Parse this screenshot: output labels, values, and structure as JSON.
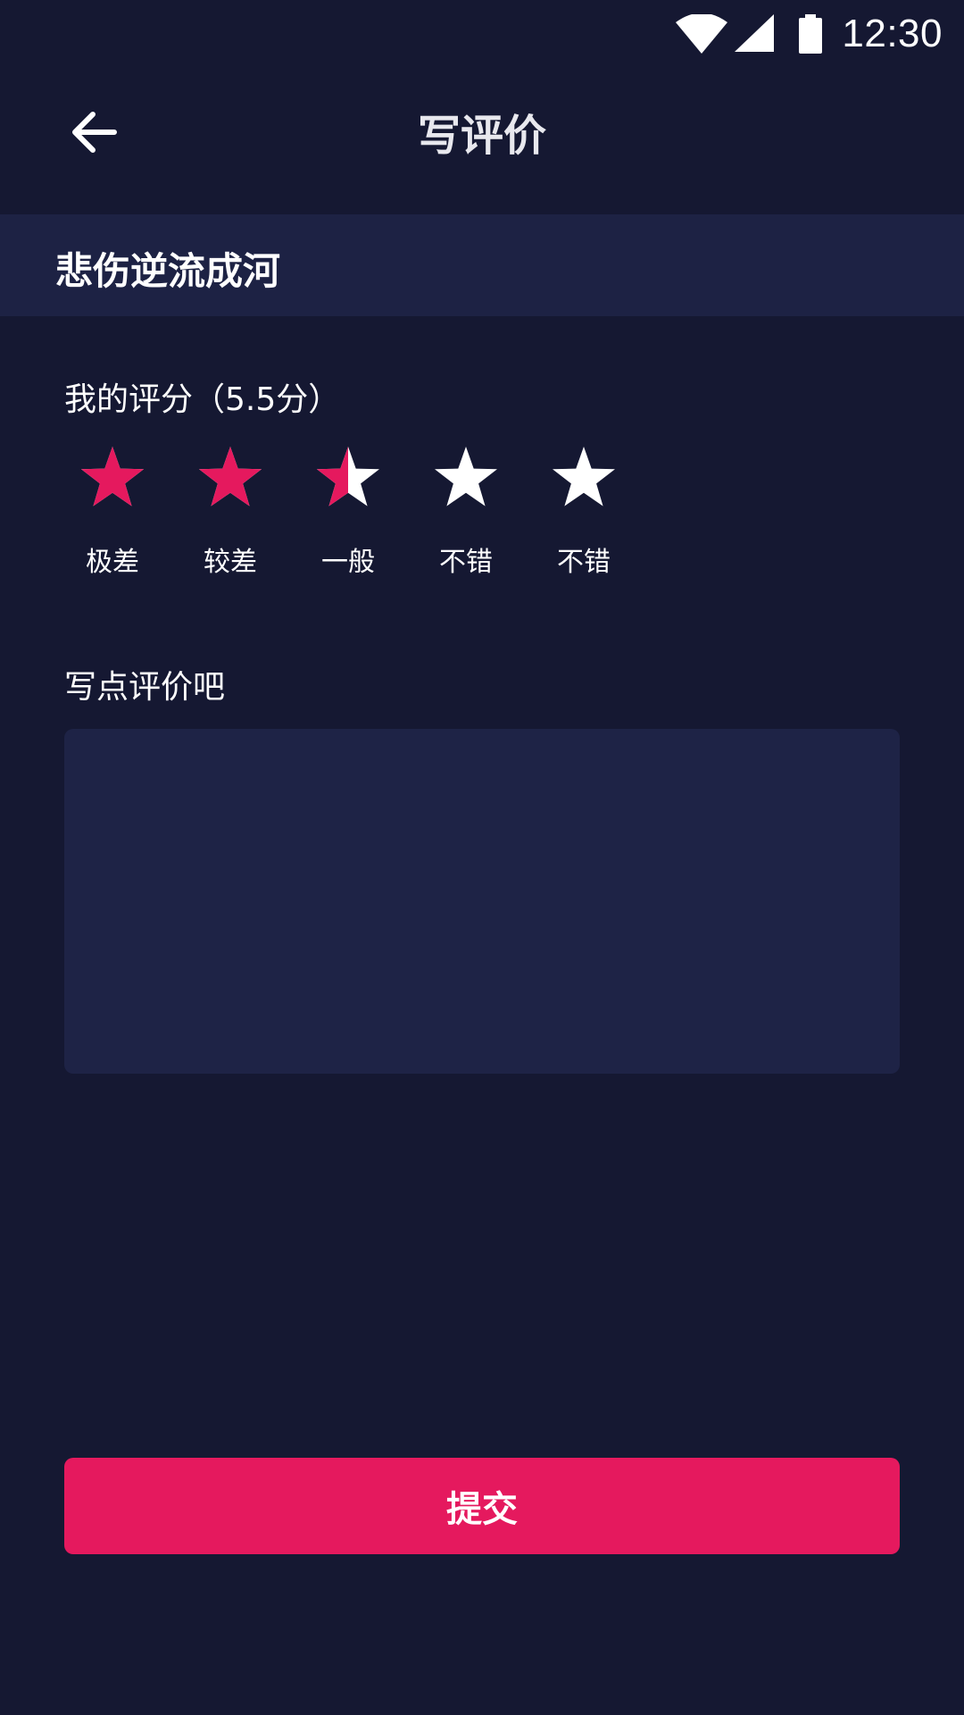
{
  "status_bar": {
    "time": "12:30",
    "icons": [
      "wifi-icon",
      "cellular-signal-icon",
      "battery-icon"
    ]
  },
  "header": {
    "title": "写评价",
    "back_icon": "arrow-left-icon"
  },
  "movie": {
    "title": "悲伤逆流成河"
  },
  "rating": {
    "label": "我的评分（5.5分）",
    "value": 2.5,
    "max": 5,
    "stars": [
      {
        "caption": "极差",
        "fill": 1
      },
      {
        "caption": "较差",
        "fill": 1
      },
      {
        "caption": "一般",
        "fill": 0.5
      },
      {
        "caption": "不错",
        "fill": 0
      },
      {
        "caption": "不错",
        "fill": 0
      }
    ]
  },
  "comment": {
    "label": "写点评价吧",
    "value": "",
    "placeholder": ""
  },
  "submit": {
    "label": "提交"
  },
  "colors": {
    "background": "#151832",
    "panel": "#1d2244",
    "input": "#1e2346",
    "accent": "#e5195e",
    "star_empty": "#ffffff"
  }
}
